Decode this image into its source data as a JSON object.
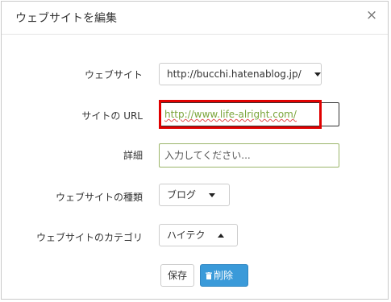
{
  "dialog": {
    "title": "ウェブサイトを編集",
    "close_label": "×"
  },
  "form": {
    "website_label": "ウェブサイト",
    "website_value": "http://bucchi.hatenablog.jp/",
    "site_url_label": "サイトの URL",
    "site_url_value": "http://www.life-alright.com/",
    "details_label": "詳細",
    "details_placeholder": "入力してください...",
    "type_label": "ウェブサイトの種類",
    "type_value": "ブログ",
    "category_label": "ウェブサイトのカテゴリ",
    "category_value": "ハイテク"
  },
  "actions": {
    "save_label": "保存",
    "delete_label": "削除"
  },
  "colors": {
    "highlight": "#e00000",
    "primary": "#3a9ad9",
    "url_text": "#7aa53a"
  },
  "icons": {
    "close": "close-icon",
    "dropdown": "caret-down-icon",
    "dropdown_open": "caret-up-icon",
    "delete": "trash-icon"
  }
}
